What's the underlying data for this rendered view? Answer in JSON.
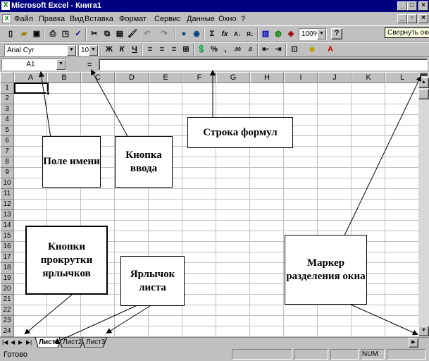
{
  "window": {
    "title": "Microsoft Excel - Книга1"
  },
  "menu": {
    "items": [
      "Файл",
      "Правка",
      "Вид",
      "Вставка",
      "Формат",
      "Сервис",
      "Данные",
      "Окно",
      "?"
    ]
  },
  "toolbar": {
    "zoom": "100%",
    "tooltip": "Свернуть окно",
    "autosum": "Σ",
    "function": "fx"
  },
  "format_toolbar": {
    "font": "Arial Cyr",
    "size": "10",
    "bold": "Ж",
    "italic": "К",
    "underline": "Ч",
    "percent": "%",
    "comma": ","
  },
  "formula_bar": {
    "name_box": "A1",
    "equals": "="
  },
  "grid": {
    "columns": [
      "A",
      "B",
      "C",
      "D",
      "E",
      "F",
      "G",
      "H",
      "I",
      "J",
      "K",
      "L"
    ],
    "rows": [
      "1",
      "2",
      "3",
      "4",
      "5",
      "6",
      "7",
      "8",
      "9",
      "10",
      "11",
      "12",
      "13",
      "14",
      "15",
      "16",
      "17",
      "18",
      "19",
      "20",
      "21",
      "22",
      "23",
      "24"
    ]
  },
  "callouts": {
    "name_box": "Поле имени",
    "enter_button": "Кнопка ввода",
    "formula_row": "Строка формул",
    "tab_scroll_buttons": "Кнопки прокрутки ярлычков",
    "sheet_tab": "Ярлычок листа",
    "split_marker": "Маркер разделения окна"
  },
  "sheets": {
    "tabs": [
      "Лист1",
      "Лист2",
      "Лист3"
    ]
  },
  "status": {
    "ready": "Готово",
    "num": "NUM"
  }
}
